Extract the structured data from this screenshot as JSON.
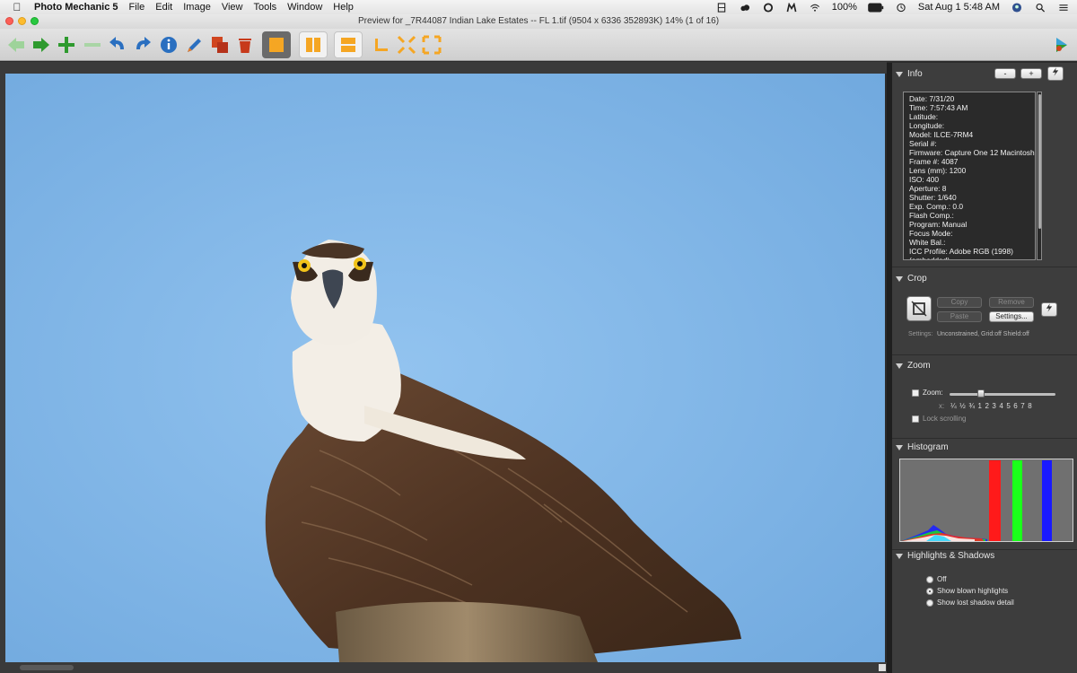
{
  "menubar": {
    "app_name": "Photo Mechanic 5",
    "items": [
      "File",
      "Edit",
      "Image",
      "View",
      "Tools",
      "Window",
      "Help"
    ],
    "battery": "100%",
    "clock": "Sat Aug 1  5:48 AM"
  },
  "window": {
    "title": "Preview for _7R44087 Indian Lake Estates -- FL 1.tif (9504 x 6336 352893K) 14% (1 of 16)"
  },
  "toolbar": {
    "icons": [
      "previous-arrow-icon",
      "next-arrow-icon",
      "plus-icon",
      "minus-icon",
      "rotate-left-icon",
      "rotate-right-icon",
      "info-icon",
      "edit-pen-icon",
      "copy-icon",
      "trash-icon",
      "single-view-icon",
      "side-by-side-icon",
      "stacked-view-icon",
      "crop-corner-icon",
      "zoom-fit-icon",
      "zoom-expand-icon",
      "camerabits-logo-icon"
    ]
  },
  "panel": {
    "info": {
      "title": "Info",
      "minus_label": "-",
      "plus_label": "+",
      "lines": [
        "Date: 7/31/20",
        "Time: 7:57:43 AM",
        "Latitude:",
        "Longitude:",
        "Model: ILCE-7RM4",
        "Serial #:",
        "Firmware: Capture One 12 Macintosh",
        "Frame #: 4087",
        "Lens (mm): 1200",
        "ISO: 400",
        "Aperture: 8",
        "Shutter: 1/640",
        "Exp. Comp.: 0.0",
        "Flash Comp.:",
        "Program: Manual",
        "Focus Mode:",
        "White Bal.:",
        "ICC Profile: Adobe RGB (1998)",
        "(embedded)"
      ]
    },
    "crop": {
      "title": "Crop",
      "copy": "Copy",
      "remove": "Remove",
      "paste": "Paste",
      "settings_button": "Settings...",
      "settings_label": "Settings:",
      "settings_value": "Unconstrained, Grid:off Shield:off"
    },
    "zoom": {
      "title": "Zoom",
      "zoom_label": "Zoom:",
      "x_label": "x:",
      "scale": [
        "¼",
        "½",
        "¾",
        "1",
        "2",
        "3",
        "4",
        "5",
        "6",
        "7",
        "8"
      ],
      "slider_value": 0.28,
      "lock_label": "Lock scrolling"
    },
    "histogram": {
      "title": "Histogram"
    },
    "highlights": {
      "title": "Highlights & Shadows",
      "options": [
        "Off",
        "Show blown highlights",
        "Show lost shadow detail"
      ],
      "selected": 1
    }
  },
  "colors": {
    "sky": "#80b4e6",
    "panel_bg": "#3d3d3d"
  }
}
